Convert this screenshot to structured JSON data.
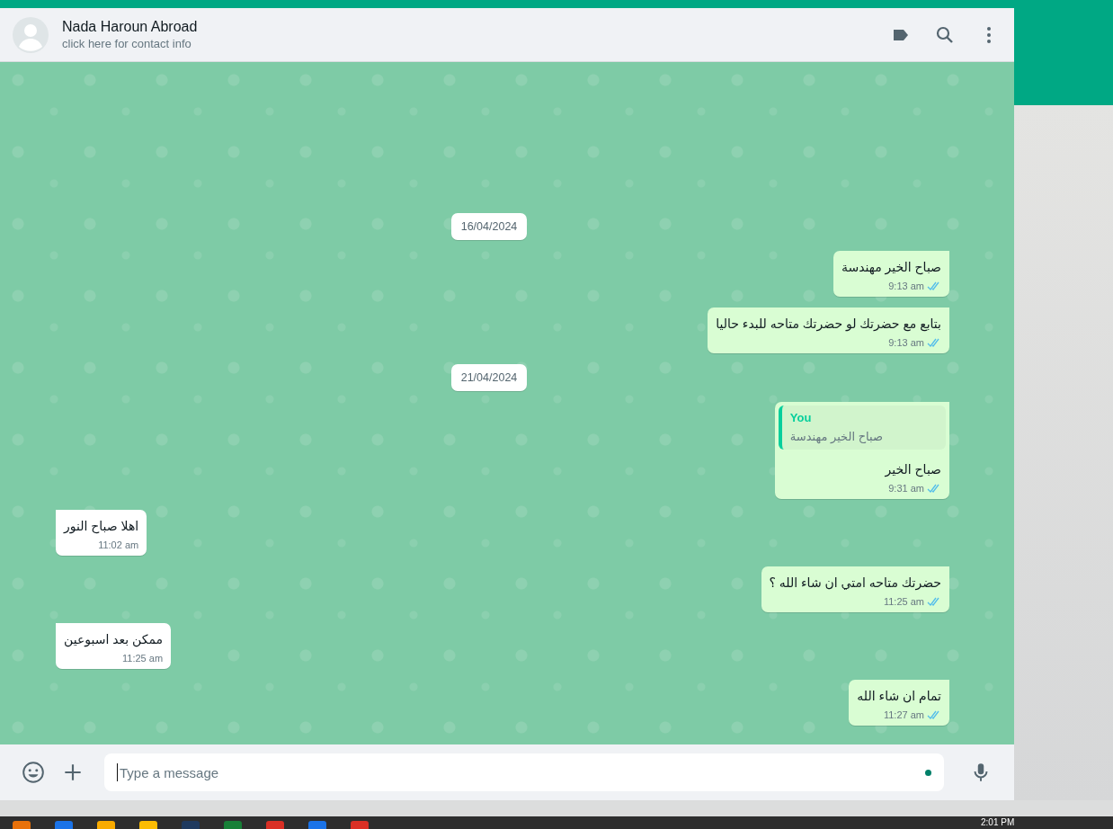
{
  "header": {
    "contact_name": "Nada Haroun Abroad",
    "subtitle": "click here for contact info"
  },
  "messages": [
    {
      "kind": "date",
      "text": "16/04/2024"
    },
    {
      "kind": "out",
      "text": "صباح الخير مهندسة",
      "time": "9:13 am",
      "read": true
    },
    {
      "kind": "out",
      "text": "بتابع مع حضرتك لو حضرتك متاحه للبدء حاليا",
      "time": "9:13 am",
      "read": true
    },
    {
      "kind": "date",
      "text": "21/04/2024"
    },
    {
      "kind": "out",
      "text": "صباح الخير",
      "time": "9:31 am",
      "read": true,
      "quote": {
        "author": "You",
        "text": "صباح الخير مهندسة"
      }
    },
    {
      "kind": "in",
      "text": "اهلا صباح النور",
      "time": "11:02 am"
    },
    {
      "kind": "out",
      "text": "حضرتك متاحه امتي ان شاء الله ؟",
      "time": "11:25 am",
      "read": true
    },
    {
      "kind": "in",
      "text": "ممكن بعد اسبوعين",
      "time": "11:25 am"
    },
    {
      "kind": "out",
      "text": "تمام ان شاء الله",
      "time": "11:27 am",
      "read": true
    }
  ],
  "composer": {
    "placeholder": "Type a message"
  },
  "taskbar": {
    "clock": "2:01 PM"
  }
}
